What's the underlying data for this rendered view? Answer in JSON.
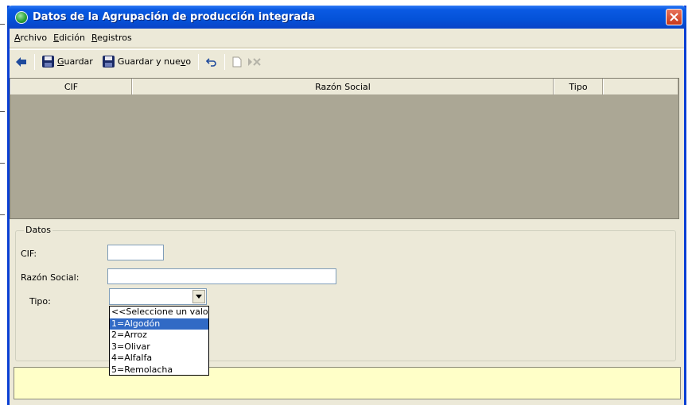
{
  "window": {
    "title": "Datos de la Agrupación de producción integrada"
  },
  "menu": [
    {
      "first": "A",
      "rest": "rchivo"
    },
    {
      "first": "E",
      "rest": "dición"
    },
    {
      "first": "R",
      "rest": "egistros"
    }
  ],
  "toolbar": {
    "save_prefix": "G",
    "save_rest": "uardar",
    "save_new_prefix": "Guardar y nue",
    "save_new_u": "v",
    "save_new_rest": "o"
  },
  "grid": {
    "columns": [
      "CIF",
      "Razón Social",
      "Tipo",
      ""
    ]
  },
  "form": {
    "group_title": "Datos",
    "cif_label": "CIF:",
    "cif_value": "",
    "razon_label": "Razón Social:",
    "razon_value": "",
    "tipo_label": "Tipo:",
    "tipo_value": ""
  },
  "tipo_options": [
    "<<Seleccione un valor>>",
    "1=Algodón",
    "2=Arroz",
    "3=Olivar",
    "4=Alfalfa",
    "5=Remolacha"
  ],
  "tipo_selected_index": 1,
  "colors": {
    "titlebar": "#0452d8",
    "selection": "#316ac5",
    "status_bg": "#ffffc8",
    "grid_bg": "#aba795"
  }
}
